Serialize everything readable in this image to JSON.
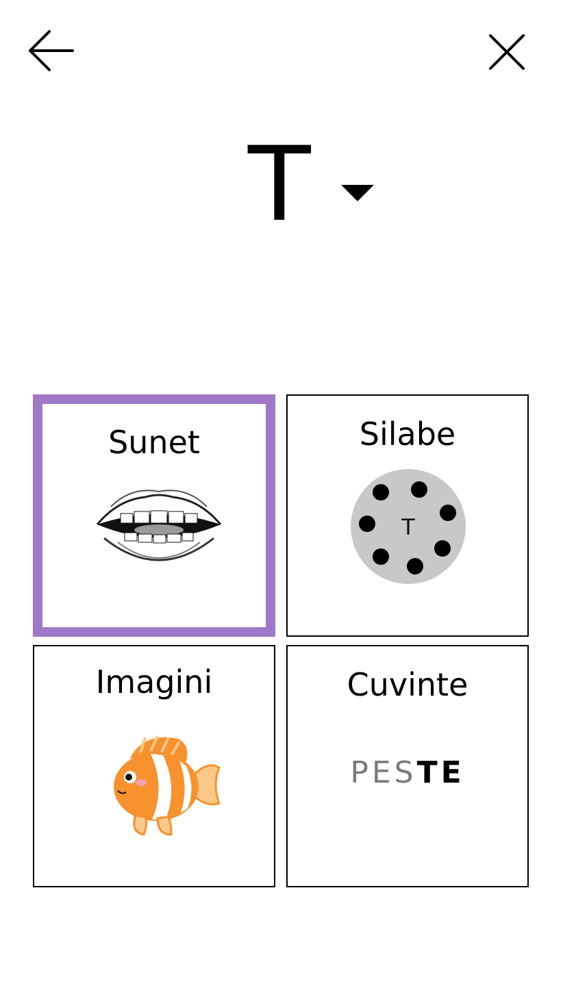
{
  "header": {
    "back_icon": "arrow-left-icon",
    "close_icon": "close-icon"
  },
  "letter_selector": {
    "letter": "T",
    "dropdown_icon": "caret-down-icon"
  },
  "cards": {
    "sunet": {
      "label": "Sunet",
      "illustration": "mouth-icon",
      "selected": true
    },
    "silabe": {
      "label": "Silabe",
      "center_letter": "T",
      "illustration": "syllable-wheel-icon"
    },
    "imagini": {
      "label": "Imagini",
      "illustration": "fish-icon"
    },
    "cuvinte": {
      "label": "Cuvinte",
      "word_prefix": "PES",
      "word_suffix": "TE"
    }
  },
  "colors": {
    "selected_border": "#a078c8",
    "wheel_gray": "#c8c8c8",
    "fish_orange": "#f7922e"
  }
}
